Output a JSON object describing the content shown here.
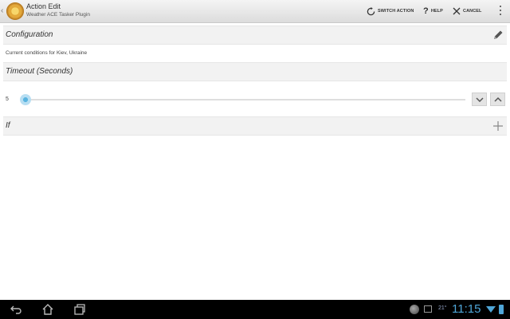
{
  "actionbar": {
    "title": "Action Edit",
    "subtitle": "Weather ACE Tasker Plugin",
    "switch_label": "SWITCH ACTION",
    "help_label": "HELP",
    "cancel_label": "CANCEL"
  },
  "configuration": {
    "header": "Configuration",
    "value": "Current conditions for Kiev, Ukraine"
  },
  "timeout": {
    "header": "Timeout (Seconds)",
    "value": "5",
    "slider_fraction": 0.0
  },
  "if_section": {
    "header": "If"
  },
  "systembar": {
    "temperature": "21°",
    "time": "11:15"
  },
  "colors": {
    "accent": "#4fa6d8",
    "header_bg": "#f2f2f2"
  }
}
